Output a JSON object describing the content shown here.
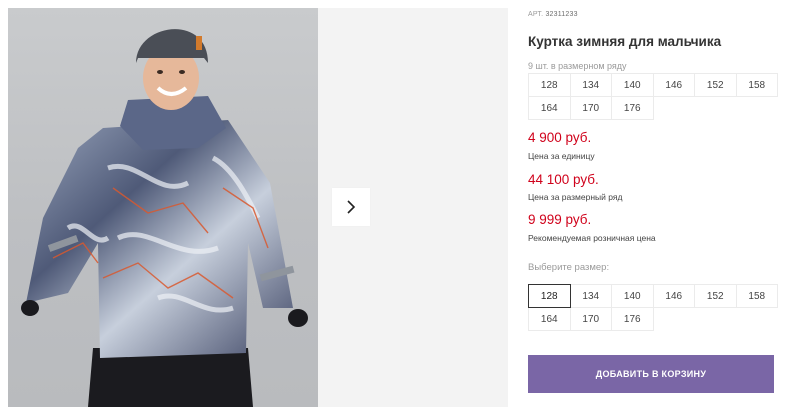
{
  "product": {
    "sku_label": "АРТ.",
    "sku_value": "32311233",
    "title": "Куртка зимняя для мальчика",
    "size_row_note": "9 шт. в размерном ряду",
    "size_row": [
      "128",
      "134",
      "140",
      "146",
      "152",
      "158",
      "164",
      "170",
      "176"
    ],
    "prices": [
      {
        "value": "4 900 руб.",
        "caption": "Цена за единицу"
      },
      {
        "value": "44 100 руб.",
        "caption": "Цена за размерный ряд"
      },
      {
        "value": "9 999 руб.",
        "caption": "Рекомендуемая розничная цена"
      }
    ],
    "choose_size_label": "Выберите размер:",
    "size_options": [
      "128",
      "134",
      "140",
      "146",
      "152",
      "158",
      "164",
      "170",
      "176"
    ],
    "selected_size": "128",
    "add_to_cart_label": "ДОБАВИТЬ В КОРЗИНУ"
  },
  "gallery": {
    "next_icon": "chevron-right-icon"
  },
  "colors": {
    "price": "#d0021b",
    "button": "#7a66a6"
  }
}
